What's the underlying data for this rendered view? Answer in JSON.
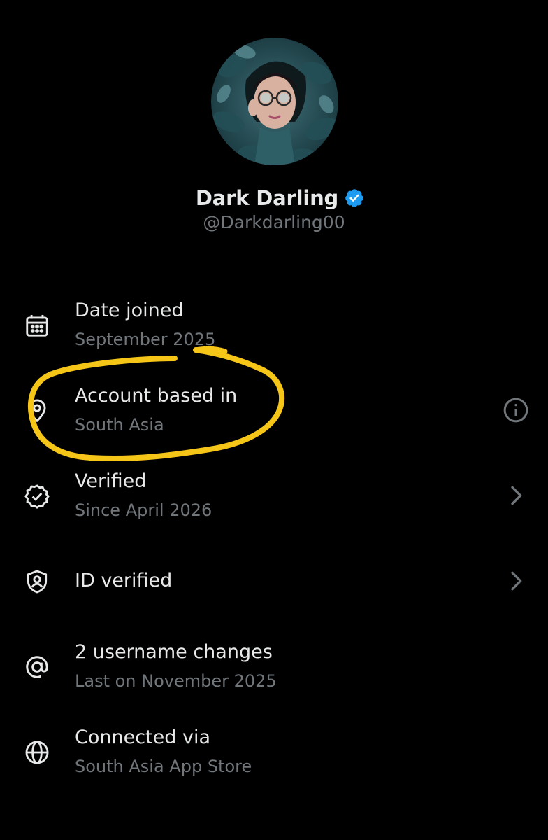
{
  "profile": {
    "display_name": "Dark Darling",
    "handle": "@Darkdarling00",
    "verified_badge_color": "#1d9bf0"
  },
  "rows": [
    {
      "title": "Date joined",
      "subtitle": "September 2025",
      "icon": "calendar-icon"
    },
    {
      "title": "Account based in",
      "subtitle": "South Asia",
      "icon": "location-pin-icon",
      "trailing": "info-icon"
    },
    {
      "title": "Verified",
      "subtitle": "Since April 2026",
      "icon": "verified-seal-icon",
      "trailing": "chevron-right-icon"
    },
    {
      "title": "ID verified",
      "icon": "id-shield-icon",
      "trailing": "chevron-right-icon"
    },
    {
      "title": "2 username changes",
      "subtitle": "Last on November 2025",
      "icon": "at-sign-icon"
    },
    {
      "title": "Connected via",
      "subtitle": "South Asia App Store",
      "icon": "globe-icon"
    }
  ],
  "colors": {
    "background": "#000000",
    "primary_text": "#e7e9ea",
    "secondary_text": "#71767b",
    "highlight_marker": "#f5c518"
  }
}
